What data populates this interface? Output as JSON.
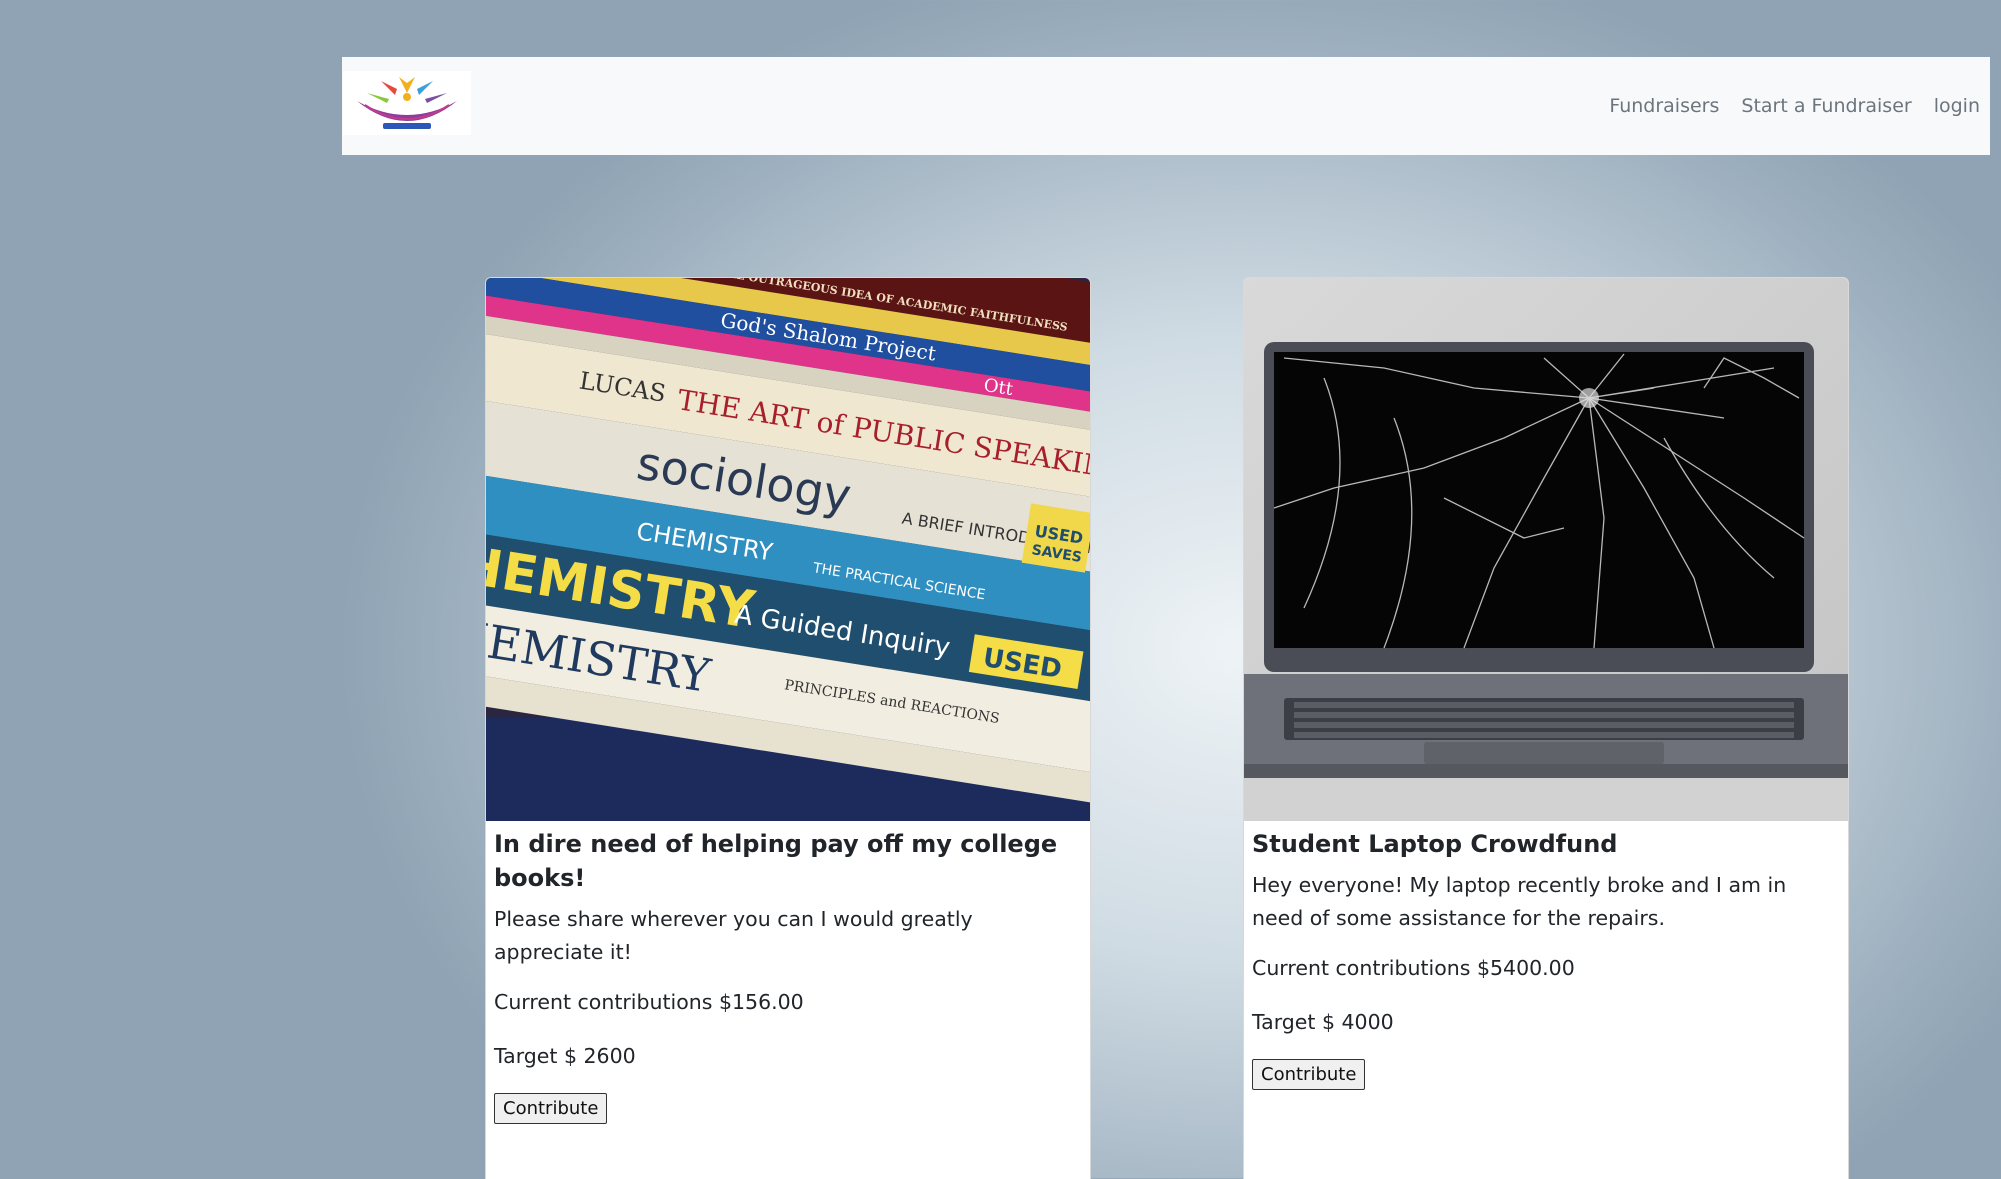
{
  "nav": {
    "logo_alt": "Fund Me",
    "links": [
      "Fundraisers",
      "Start a Fundraiser",
      "login"
    ]
  },
  "cards": [
    {
      "title": "In dire need of helping pay off my college books!",
      "description": "Please share wherever you can I would greatly appreciate it!",
      "contributions": "Current contributions $156.00",
      "target": "Target $ 2600",
      "button": "Contribute",
      "image_name": "college-textbooks-photo",
      "book_spines": [
        "THE OUTRAGEOUS IDEA OF ACADEMIC FAITHFULNESS",
        "God's Shalom Project",
        "Ott",
        "LUCAS THE ART of PUBLIC SPEAKING",
        "sociology",
        "A BRIEF INTRODUCTION",
        "CHEMISTRY THE PRACTICAL SCIENCE",
        "HEMISTRY A Guided Inquiry",
        "USED",
        "HEMISTRY PRINCIPLES and REACTIONS",
        "USED SAVES"
      ]
    },
    {
      "title": "Student Laptop Crowdfund",
      "description": "Hey everyone! My laptop recently broke and I am in need of some assistance for the repairs.",
      "contributions": "Current contributions $5400.00",
      "target": "Target $ 4000",
      "button": "Contribute",
      "image_name": "broken-laptop-photo"
    }
  ]
}
